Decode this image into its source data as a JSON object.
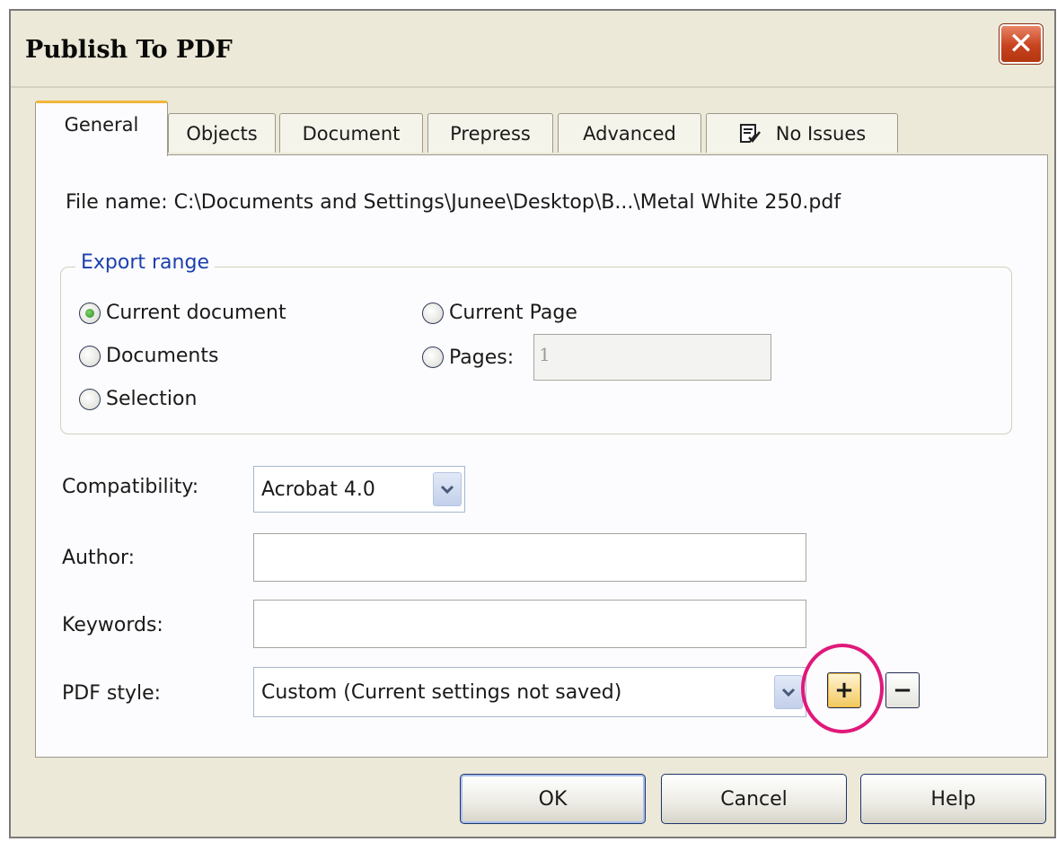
{
  "window": {
    "title": "Publish To PDF",
    "close_glyph": "✕"
  },
  "tabs": [
    {
      "label": "General",
      "active": true
    },
    {
      "label": "Objects",
      "active": false
    },
    {
      "label": "Document",
      "active": false
    },
    {
      "label": "Prepress",
      "active": false
    },
    {
      "label": "Advanced",
      "active": false
    },
    {
      "label": "No Issues",
      "active": false,
      "icon": "checklist-icon"
    }
  ],
  "general": {
    "file_name_label": "File name:",
    "file_name_value": "C:\\Documents and Settings\\Junee\\Desktop\\B...\\Metal White 250.pdf",
    "export_range": {
      "title": "Export range",
      "options": [
        {
          "label": "Current document",
          "checked": true
        },
        {
          "label": "Documents",
          "checked": false
        },
        {
          "label": "Selection",
          "checked": false
        },
        {
          "label": "Current Page",
          "checked": false
        },
        {
          "label": "Pages:",
          "checked": false
        }
      ],
      "pages_value": "1"
    },
    "compatibility": {
      "label": "Compatibility:",
      "value": "Acrobat 4.0"
    },
    "author": {
      "label": "Author:",
      "value": ""
    },
    "keywords": {
      "label": "Keywords:",
      "value": ""
    },
    "pdf_style": {
      "label": "PDF style:",
      "value": "Custom (Current settings not saved)"
    },
    "add_style_glyph": "+",
    "remove_style_glyph": "−"
  },
  "buttons": {
    "ok": "OK",
    "cancel": "Cancel",
    "help": "Help"
  },
  "colors": {
    "highlight": "#e0197a",
    "group_title": "#1b3fae",
    "close_button": "#c8431f"
  }
}
